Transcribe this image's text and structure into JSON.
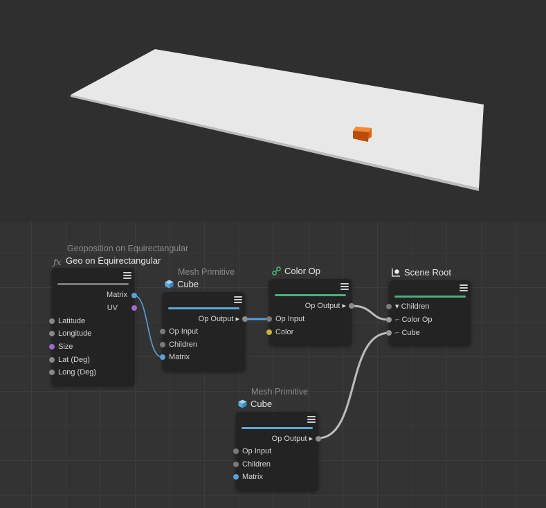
{
  "viewport": {
    "plane_color": "#e8e8e8",
    "cube_color": "#e0620f"
  },
  "nodes": {
    "geo": {
      "subtitle": "Geoposition on Equirectangular",
      "title": "Geo on Equirectangular",
      "icon": "fx-icon",
      "outputs": [
        {
          "label": "Matrix",
          "color": "#5a9fd8"
        },
        {
          "label": "UV",
          "color": "#9b6cc9"
        }
      ],
      "inputs": [
        {
          "label": "Latitude",
          "color": "#8d8d8d"
        },
        {
          "label": "Longitude",
          "color": "#8d8d8d"
        },
        {
          "label": "Size",
          "color": "#9b6cc9"
        },
        {
          "label": "Lat (Deg)",
          "color": "#8d8d8d"
        },
        {
          "label": "Long (Deg)",
          "color": "#8d8d8d"
        }
      ]
    },
    "mesh1": {
      "subtitle": "Mesh Primitive",
      "title": "Cube",
      "icon": "cube-icon",
      "output": "Op Output",
      "inputs": [
        {
          "label": "Op Input",
          "color": "#7a7a7a"
        },
        {
          "label": "Children",
          "color": "#7a7a7a"
        },
        {
          "label": "Matrix",
          "color": "#5a9fd8"
        }
      ]
    },
    "colorop": {
      "title": "Color Op",
      "icon": "color-op-icon",
      "output": "Op Output",
      "inputs": [
        {
          "label": "Op Input",
          "color": "#7a7a7a"
        },
        {
          "label": "Color",
          "color": "#c8b33a"
        }
      ]
    },
    "sceneroot": {
      "title": "Scene Root",
      "icon": "scene-root-icon",
      "inputs": [
        {
          "label": "Children",
          "prefix": "▾ "
        },
        {
          "label": "Color Op",
          "prefix": "⌐ "
        },
        {
          "label": "Cube",
          "prefix": "⌐ "
        }
      ]
    },
    "mesh2": {
      "subtitle": "Mesh Primitive",
      "title": "Cube",
      "icon": "cube-icon",
      "output": "Op Output",
      "inputs": [
        {
          "label": "Op Input",
          "color": "#7a7a7a"
        },
        {
          "label": "Children",
          "color": "#7a7a7a"
        },
        {
          "label": "Matrix",
          "color": "#5a9fd8"
        }
      ]
    }
  },
  "colors": {
    "mesh_bar": "#5fa9d9",
    "color_bar": "#4caf7d",
    "wire_gray": "#bdbdbd",
    "wire_blue": "#5a9fd8"
  }
}
